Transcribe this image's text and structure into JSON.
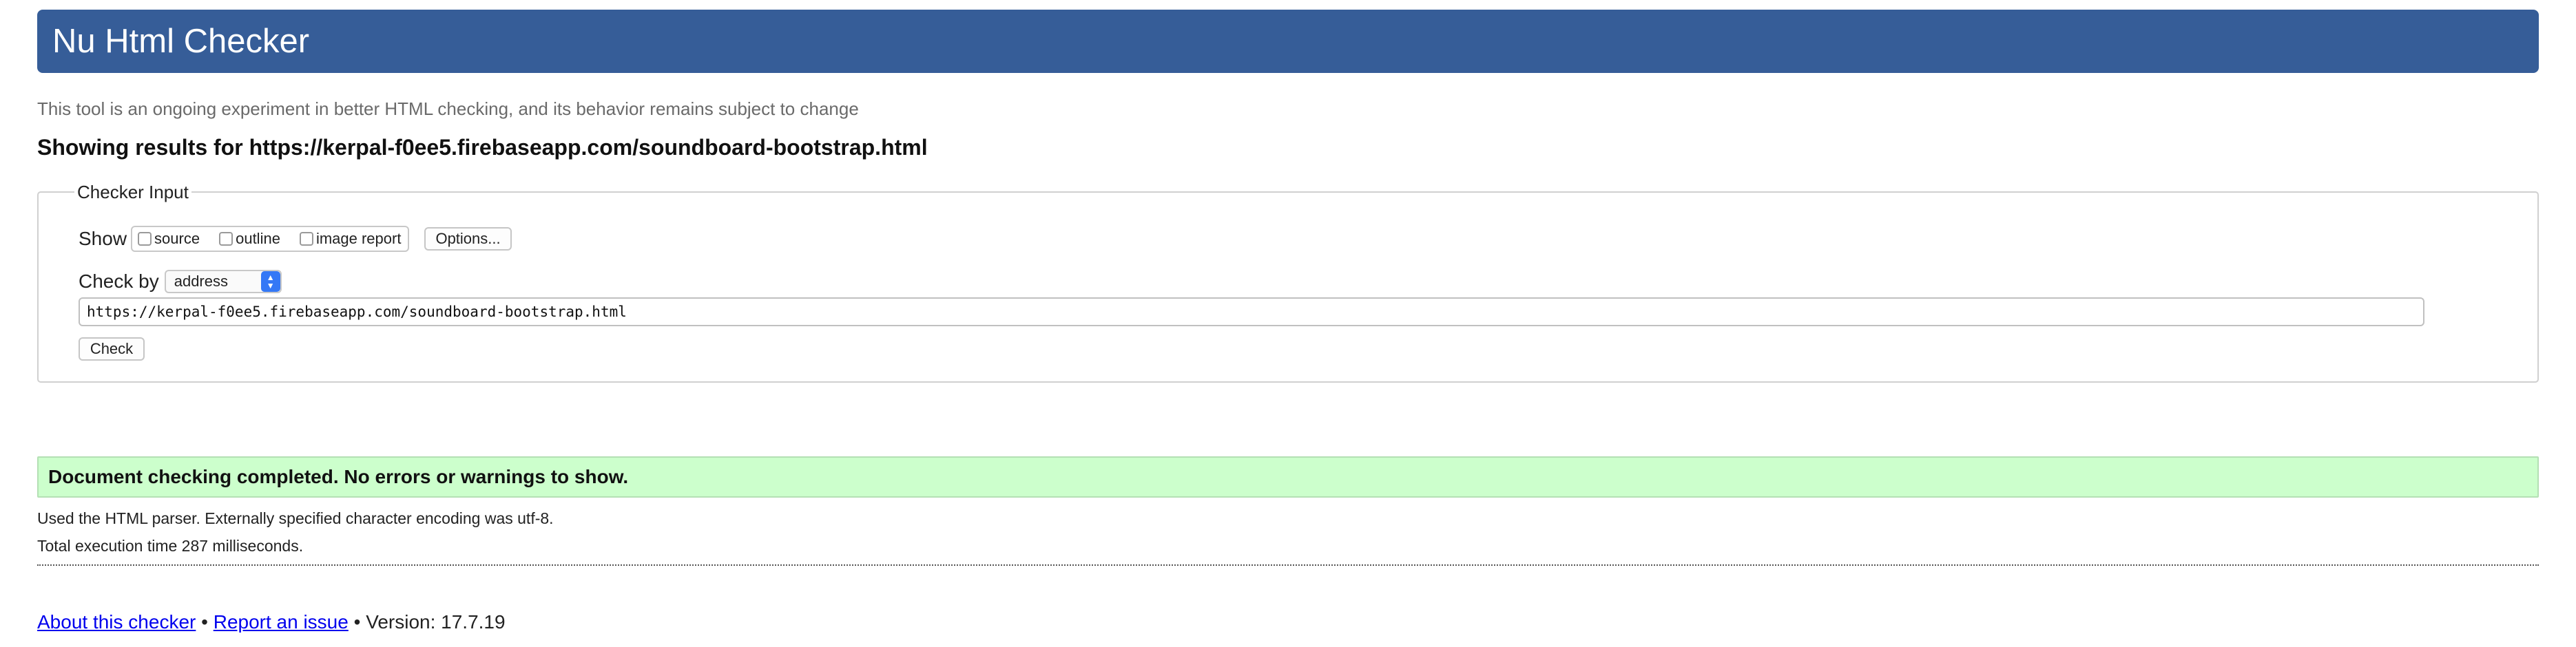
{
  "header": {
    "title": "Nu Html Checker"
  },
  "tagline": "This tool is an ongoing experiment in better HTML checking, and its behavior remains subject to change",
  "results_title": "Showing results for https://kerpal-f0ee5.firebaseapp.com/soundboard-bootstrap.html",
  "checker_input": {
    "legend": "Checker Input",
    "show_label": "Show",
    "checkboxes": [
      {
        "label": "source",
        "checked": false
      },
      {
        "label": "outline",
        "checked": false
      },
      {
        "label": "image report",
        "checked": false
      }
    ],
    "options_button": "Options...",
    "check_by_label": "Check by",
    "check_by_value": "address",
    "url_value": "https://kerpal-f0ee5.firebaseapp.com/soundboard-bootstrap.html",
    "check_button": "Check"
  },
  "result": {
    "success_message": "Document checking completed. No errors or warnings to show.",
    "parser_info": "Used the HTML parser. Externally specified character encoding was utf-8.",
    "execution_time": "Total execution time 287 milliseconds."
  },
  "footer": {
    "about_link": "About this checker",
    "separator": "•",
    "report_link": "Report an issue",
    "version": "Version: 17.7.19"
  },
  "colors": {
    "banner": "#365d98",
    "success_bg": "#ccffcc",
    "link": "#0000ee",
    "select_accent": "#3478f6"
  }
}
